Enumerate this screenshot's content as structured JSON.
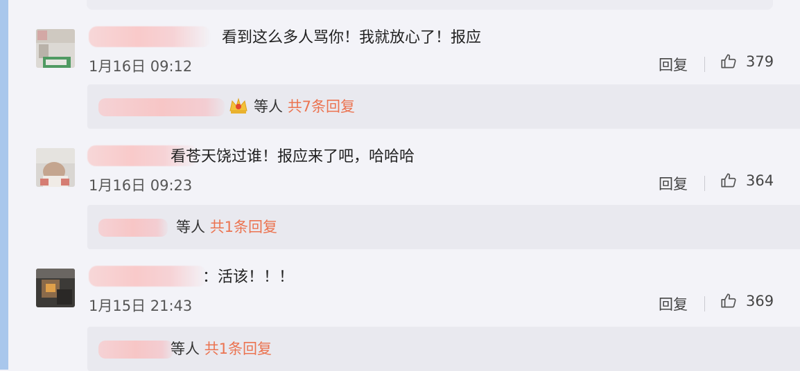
{
  "comments": [
    {
      "text": "看到这么多人骂你！我就放心了！报应",
      "date": "1月16日 09:12",
      "reply_label": "回复",
      "likes": "379",
      "replies_by": "等人",
      "replies_link": "共7条回复"
    },
    {
      "text": "看苍天饶过谁！报应来了吧，哈哈哈",
      "date": "1月16日 09:23",
      "reply_label": "回复",
      "likes": "364",
      "replies_by": "等人",
      "replies_link": "共1条回复"
    },
    {
      "text": "：活该！！！",
      "date": "1月15日 21:43",
      "reply_label": "回复",
      "likes": "369",
      "replies_by": "等人",
      "replies_link": "共1条回复"
    }
  ],
  "icons": {
    "like": "thumbs-up-icon",
    "crown": "crown-icon"
  },
  "colors": {
    "accent_link": "#eb7350",
    "background": "#f3f3f8",
    "reply_box": "#e9e9ef",
    "left_rail": "#a9c7ec"
  }
}
